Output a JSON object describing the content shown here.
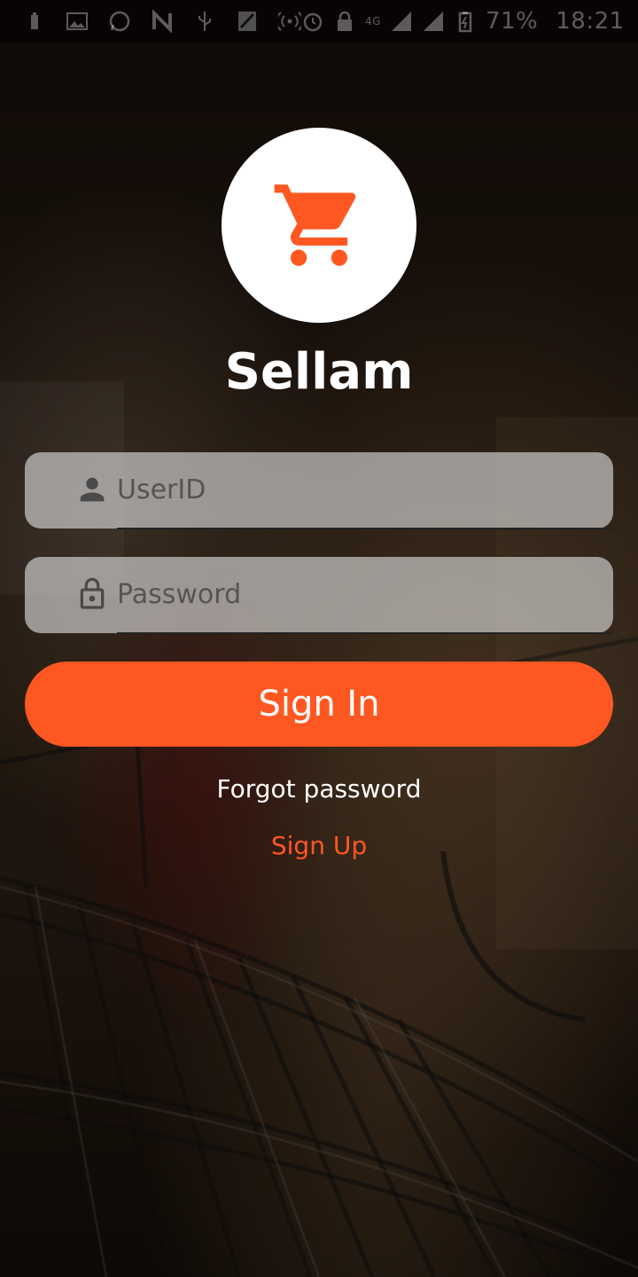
{
  "status_bar": {
    "battery_percent": "71%",
    "time": "18:21",
    "network_label": "4G",
    "left_icons": [
      "notification-icon",
      "gallery-icon",
      "whatsapp-icon",
      "n-app-icon",
      "usb-icon",
      "signal-box-icon",
      "hotspot-icon"
    ],
    "right_icons": [
      "alarm-icon",
      "lock-icon",
      "signal-icon",
      "signal-icon-2",
      "battery-icon"
    ]
  },
  "app": {
    "title": "Sellam",
    "logo_icon": "shopping-cart-icon"
  },
  "login_form": {
    "userid_placeholder": "UserID",
    "userid_value": "",
    "userid_icon": "person-icon",
    "password_placeholder": "Password",
    "password_value": "",
    "password_icon": "lock-icon",
    "signin_label": "Sign In",
    "forgot_label": "Forgot password",
    "signup_label": "Sign Up"
  },
  "colors": {
    "accent": "#ff5722",
    "text_light": "#ffffff",
    "field_bg": "#e1e1e1"
  }
}
